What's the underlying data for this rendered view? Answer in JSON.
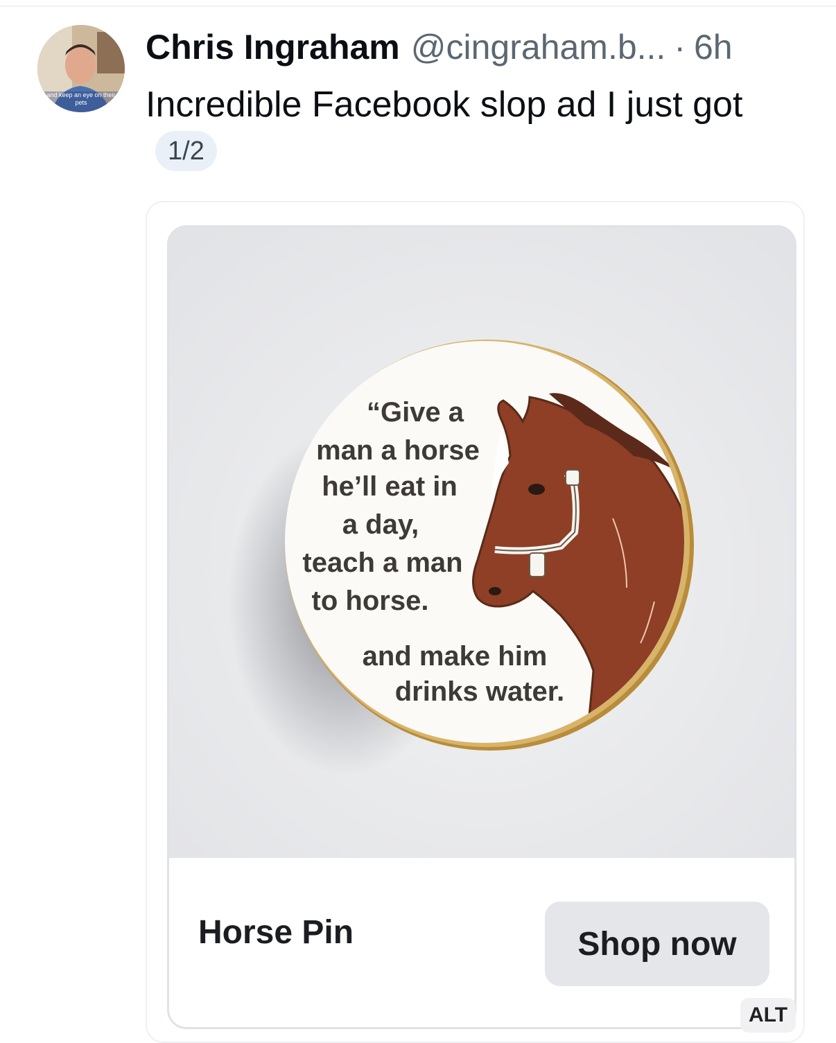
{
  "post": {
    "author_name": "Chris Ingraham",
    "author_handle": "@cingraham.b...",
    "separator": "·",
    "time": "6h",
    "text": "Incredible Facebook slop ad I just got",
    "image_count": "1/2",
    "avatar_caption_line1": "and keep an eye on their",
    "avatar_caption_line2": "pets"
  },
  "ad": {
    "pin_quote_lines": [
      "“Give a",
      "man a horse",
      "he’ll eat in",
      "a day,",
      "teach a man",
      "to horse.",
      "and make him",
      "drinks water."
    ],
    "product_title": "Horse Pin",
    "cta_label": "Shop now",
    "alt_label": "ALT"
  },
  "colors": {
    "horse_brown": "#8e3f25",
    "pin_gold": "#c8a04c",
    "photo_background": "#e9eaec",
    "button_bg": "#e4e6ea"
  }
}
